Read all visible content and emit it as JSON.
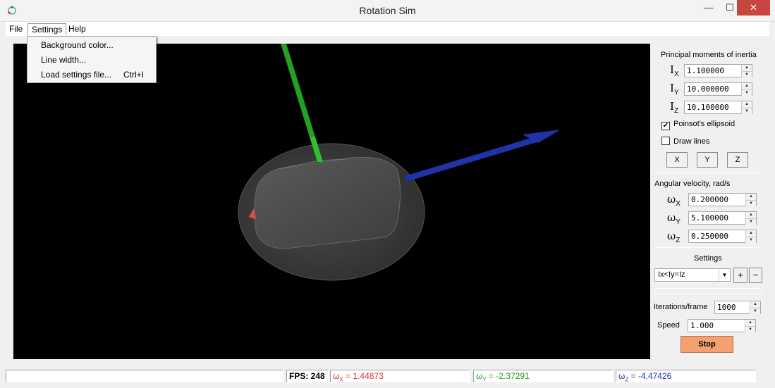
{
  "window": {
    "title": "Rotation Sim",
    "minimize": "—",
    "maximize": "☐",
    "close": "✕"
  },
  "menubar": {
    "file": "File",
    "settings": "Settings",
    "help": "Help"
  },
  "settings_menu": {
    "background_color": "Background color...",
    "line_width": "Line width...",
    "load_settings": "Load settings file...",
    "load_settings_shortcut": "Ctrl+I"
  },
  "inertia": {
    "title": "Principal moments of inertia",
    "symbol": "I",
    "ix_sub": "X",
    "iy_sub": "Y",
    "iz_sub": "Z",
    "ix": "1.100000",
    "iy": "10.000000",
    "iz": "10.100000"
  },
  "options": {
    "poinsot_label": "Poinsot's ellipsoid",
    "poinsot_checked": "✔",
    "draw_lines_label": "Draw lines",
    "draw_lines_checked": "",
    "x_button": "X",
    "y_button": "Y",
    "z_button": "Z"
  },
  "angular": {
    "title": "Angular velocity, rad/s",
    "symbol": "ω",
    "wx_sub": "X",
    "wy_sub": "Y",
    "wz_sub": "Z",
    "wx": "0.200000",
    "wy": "5.100000",
    "wz": "0.250000"
  },
  "settings": {
    "title": "Settings",
    "preset": "Ix<Iy=Iz",
    "add": "+",
    "remove": "−"
  },
  "sim": {
    "iterations_label": "Iterations/frame",
    "iterations": "1000",
    "speed_label": "Speed",
    "speed": "1.000",
    "stop": "Stop"
  },
  "status": {
    "fps": "FPS: 248",
    "wx_label": "ω",
    "wx_sub": "X",
    "wx_value": " = 1.44873",
    "wy_label": "ω",
    "wy_sub": "Y",
    "wy_value": " = -2.37291",
    "wz_label": "ω",
    "wz_sub": "Z",
    "wz_value": " = -4.47426"
  },
  "colors": {
    "x_axis": "#e03030",
    "y_axis": "#22a022",
    "z_axis": "#2233aa",
    "stop_button": "#f4a06f",
    "viewport_bg": "#000000"
  }
}
